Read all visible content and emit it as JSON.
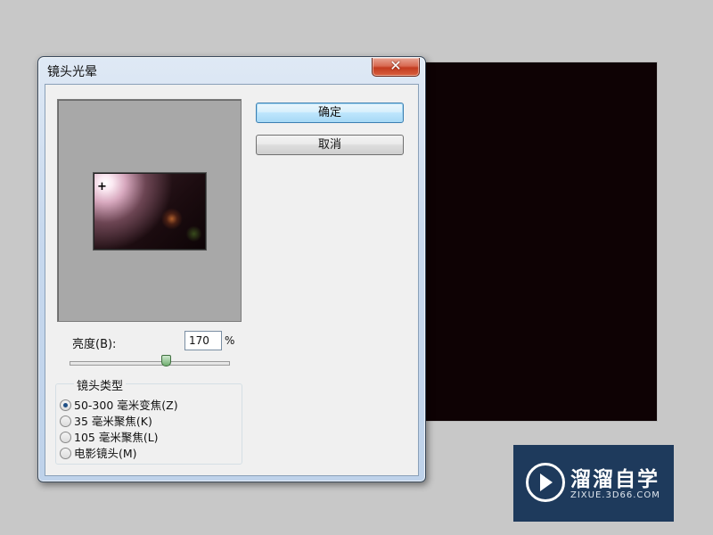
{
  "dialog": {
    "title": "镜头光晕",
    "close_label": "✕"
  },
  "buttons": {
    "ok": "确定",
    "cancel": "取消"
  },
  "preview": {
    "crosshair": "+"
  },
  "brightness": {
    "label": "亮度(B):",
    "value": "170",
    "unit": "%",
    "slider_fraction": 0.6
  },
  "lens_type": {
    "title": "镜头类型",
    "options": [
      {
        "label": "50-300 毫米变焦(Z)",
        "selected": true
      },
      {
        "label": "35 毫米聚焦(K)",
        "selected": false
      },
      {
        "label": "105 毫米聚焦(L)",
        "selected": false
      },
      {
        "label": "电影镜头(M)",
        "selected": false
      }
    ]
  },
  "watermark": {
    "name": "溜溜自学",
    "url": "ZIXUE.3D66.COM"
  },
  "colors": {
    "canvas": "#0e0204",
    "background": "#c8c8c8",
    "watermark_bg": "#1e3a5c"
  }
}
